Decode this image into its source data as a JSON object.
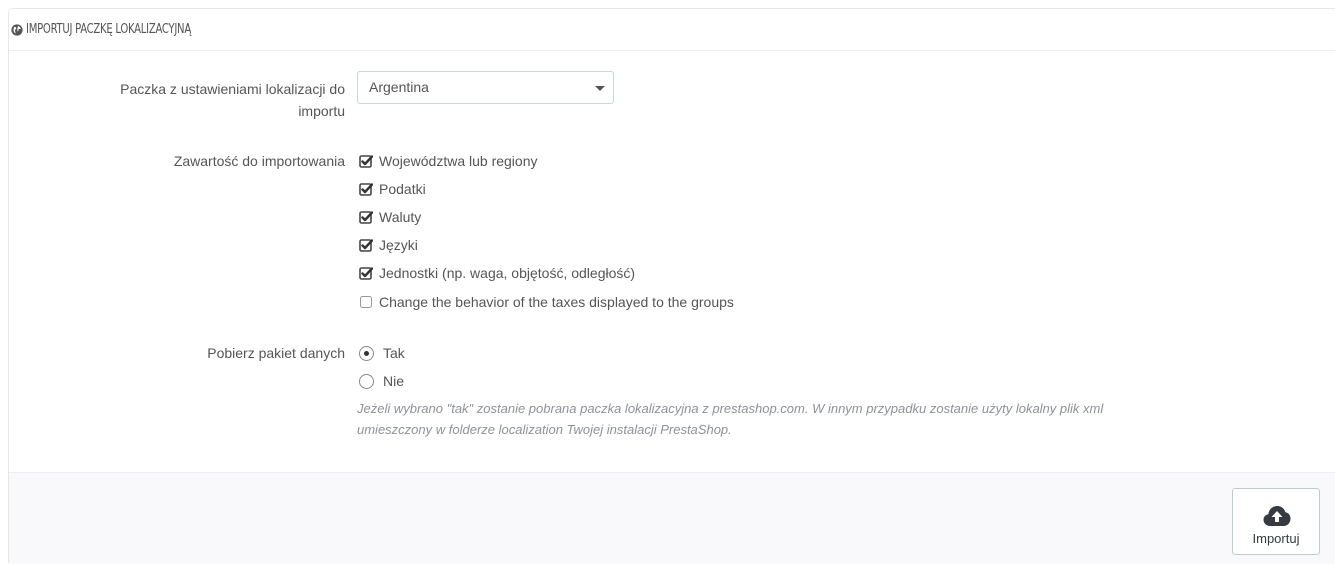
{
  "panel": {
    "title": "IMPORTUJ PACZKĘ LOKALIZACYJNĄ",
    "title_icon": "globe-icon"
  },
  "pack_field": {
    "label_line1": "Paczka z ustawieniami lokalizacji do",
    "label_line2": "importu",
    "selected": "Argentina"
  },
  "content_field": {
    "label": "Zawartość do importowania",
    "options": [
      {
        "label": "Województwa lub regiony",
        "checked": true
      },
      {
        "label": "Podatki",
        "checked": true
      },
      {
        "label": "Waluty",
        "checked": true
      },
      {
        "label": "Języki",
        "checked": true
      },
      {
        "label": "Jednostki (np. waga, objętość, odległość)",
        "checked": true
      },
      {
        "label": "Change the behavior of the taxes displayed to the groups",
        "checked": false
      }
    ]
  },
  "download_field": {
    "label": "Pobierz pakiet danych",
    "options": [
      {
        "label": "Tak",
        "selected": true
      },
      {
        "label": "Nie",
        "selected": false
      }
    ],
    "help_line1": "Jeżeli wybrano \"tak\" zostanie pobrana paczka lokalizacyjna z prestashop.com. W innym przypadku zostanie użyty lokalny plik xml",
    "help_line2": "umieszczony w folderze localization Twojej instalacji PrestaShop."
  },
  "footer": {
    "import_label": "Importuj",
    "import_icon": "cloud-upload-icon"
  }
}
